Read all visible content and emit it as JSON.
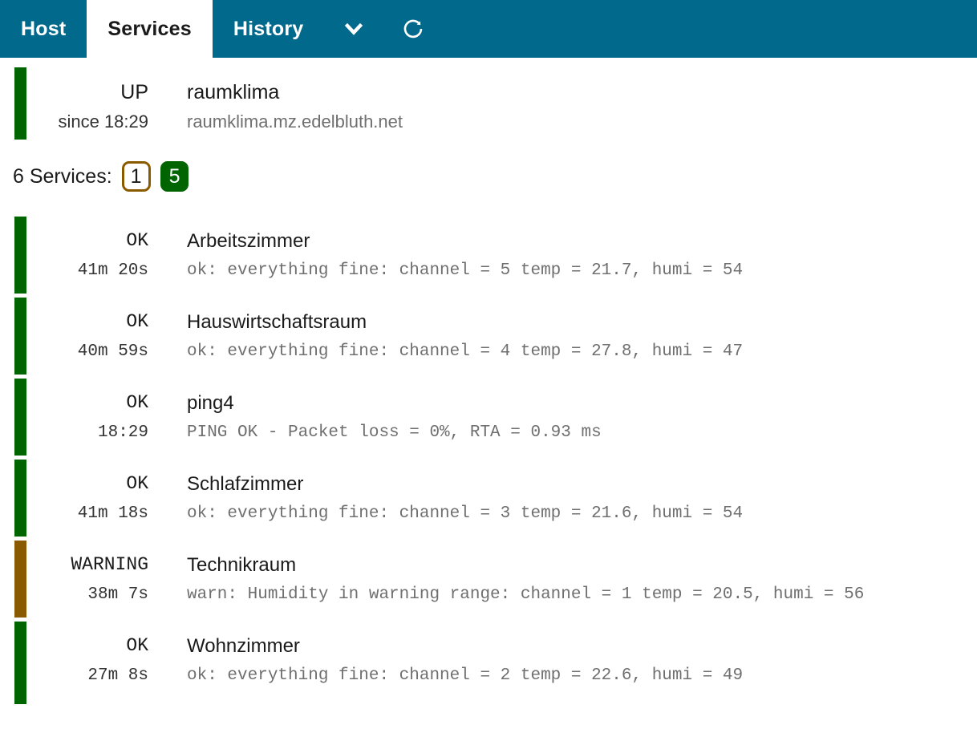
{
  "tabs": [
    {
      "label": "Host",
      "active": false,
      "name": "tab-host"
    },
    {
      "label": "Services",
      "active": true,
      "name": "tab-services"
    },
    {
      "label": "History",
      "active": false,
      "name": "tab-history"
    }
  ],
  "toolbar": {
    "dropdown_icon": "chevron-down-icon",
    "refresh_icon": "refresh-icon"
  },
  "host": {
    "state": "UP",
    "since": "since 18:29",
    "name": "raumklima",
    "address": "raumklima.mz.edelbluth.net",
    "state_color": "#006400"
  },
  "services_summary": {
    "label": "6 Services:",
    "total": 6,
    "badges": [
      {
        "count": "1",
        "state": "WARNING",
        "color": "#8a5a00"
      },
      {
        "count": "5",
        "state": "OK",
        "color": "#006400"
      }
    ]
  },
  "colors": {
    "header_teal": "#00698c",
    "ok_green": "#006400",
    "warning_brown": "#8a5a00",
    "text_primary": "#1a1a1a",
    "text_muted": "#6f6f6f"
  },
  "services": [
    {
      "state": "OK",
      "duration": "41m 20s",
      "name": "Arbeitszimmer",
      "output": "ok: everything fine: channel = 5 temp = 21.7, humi = 54",
      "state_class": "state-ok"
    },
    {
      "state": "OK",
      "duration": "40m 59s",
      "name": "Hauswirtschaftsraum",
      "output": "ok: everything fine: channel = 4 temp = 27.8, humi = 47",
      "state_class": "state-ok"
    },
    {
      "state": "OK",
      "duration": "18:29",
      "name": "ping4",
      "output": "PING OK - Packet loss = 0%, RTA = 0.93 ms",
      "state_class": "state-ok"
    },
    {
      "state": "OK",
      "duration": "41m 18s",
      "name": "Schlafzimmer",
      "output": "ok: everything fine: channel = 3 temp = 21.6, humi = 54",
      "state_class": "state-ok"
    },
    {
      "state": "WARNING",
      "duration": "38m 7s",
      "name": "Technikraum",
      "output": "warn: Humidity in warning range: channel = 1 temp = 20.5, humi = 56",
      "state_class": "state-warning"
    },
    {
      "state": "OK",
      "duration": "27m 8s",
      "name": "Wohnzimmer",
      "output": "ok: everything fine: channel = 2 temp = 22.6, humi = 49",
      "state_class": "state-ok"
    }
  ]
}
